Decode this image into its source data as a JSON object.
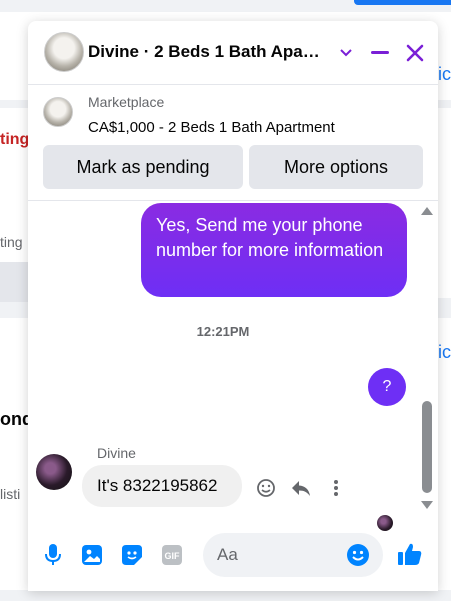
{
  "colors": {
    "accent": "#6e2ff5",
    "bubble_gradient_start": "#8a2be2",
    "icon_blue": "#0084ff",
    "header_purple": "#7a1fd6",
    "background_red_text": "#c52424",
    "background_link": "#1877f2"
  },
  "background": {
    "fragment_1": "ting",
    "fragment_2": "ting",
    "fragment_3": "ond",
    "fragment_4": "listi",
    "fragment_5": "ic",
    "fragment_6": "ic"
  },
  "header": {
    "title": "Divine · 2 Beds 1 Bath Apa…",
    "chevron_icon": "chevron-down-icon",
    "minimize_icon": "minimize-icon",
    "close_icon": "close-icon"
  },
  "listing": {
    "label": "Marketplace",
    "title": "CA$1,000 - 2 Beds 1 Bath Apartment",
    "buttons": {
      "pending": "Mark as pending",
      "more": "More options"
    }
  },
  "messages": {
    "outgoing_1": "Yes, Send me your phone number for more information",
    "timestamp": "12:21PM",
    "outgoing_2": "?",
    "sender_name": "Divine",
    "incoming_1": "It's 8322195862",
    "icons": [
      "smile-icon",
      "reply-icon",
      "more-options-icon"
    ]
  },
  "composer": {
    "placeholder": "Aa",
    "icons": [
      "microphone-icon",
      "image-icon",
      "sticker-icon",
      "gif-icon",
      "emoji-icon",
      "thumbs-up-icon"
    ],
    "gif_label": "GIF"
  }
}
